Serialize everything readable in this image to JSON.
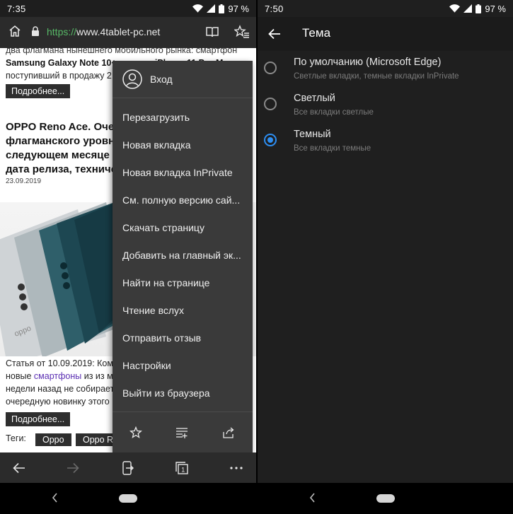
{
  "left": {
    "status": {
      "time": "7:35",
      "battery": "97 %"
    },
    "address": {
      "scheme": "https://",
      "host": "www.4tablet-pc.net"
    },
    "page": {
      "line1": "два флагмана нынешнего мобильного рынка: смартфон",
      "line2_bold1": "Samsung Galaxy Note 10+",
      "line2_mid": ", а также ",
      "line2_bold2": "iPhone 11 Pro Max",
      "line3": "поступивший в продажу 2",
      "more1": "Подробнее...",
      "headline1": "OPPO Reno Ace. Очер",
      "headline2": "флагманского уровня",
      "headline3": "следующем месяце (",
      "headline4": "дата релиза, техниче",
      "date": "23.09.2019",
      "article1": "Статья от 10.09.2019: Ком",
      "article2_pre": "новые ",
      "article2_link": "смартфоны",
      "article2_post": " из из м",
      "article3": "недели назад не собирает",
      "article4": "очередную новинку этого",
      "more2": "Подробнее...",
      "tags_label": "Теги:",
      "tags": [
        "Oppo",
        "Oppo Re"
      ]
    },
    "menu": {
      "signin": "Вход",
      "items": [
        "Перезагрузить",
        "Новая вкладка",
        "Новая вкладка InPrivate",
        "См. полную версию сай...",
        "Скачать страницу",
        "Добавить на главный эк...",
        "Найти на странице",
        "Чтение вслух",
        "Отправить отзыв",
        "Настройки",
        "Выйти из браузера"
      ]
    },
    "icons": {
      "home": "home-icon",
      "lock": "lock-icon",
      "reading": "reading-view-icon",
      "favorites": "favorites-list-icon",
      "back": "back-arrow-icon",
      "forward": "forward-arrow-icon",
      "share": "send-to-device-icon",
      "tabs": "tabs-icon",
      "more": "more-dots-icon"
    }
  },
  "right": {
    "status": {
      "time": "7:50",
      "battery": "97 %"
    },
    "title": "Тема",
    "options": [
      {
        "title": "По умолчанию (Microsoft Edge)",
        "subtitle": "Светлые вкладки, темные вкладки InPrivate",
        "selected": false
      },
      {
        "title": "Светлый",
        "subtitle": "Все вкладки светлые",
        "selected": false
      },
      {
        "title": "Темный",
        "subtitle": "Все вкладки темные",
        "selected": true
      }
    ]
  },
  "colors": {
    "accent": "#2d8ef2",
    "url_scheme": "#57b867",
    "menu_bg": "#3a3a3a",
    "theme_bg": "#1f1f1f"
  }
}
